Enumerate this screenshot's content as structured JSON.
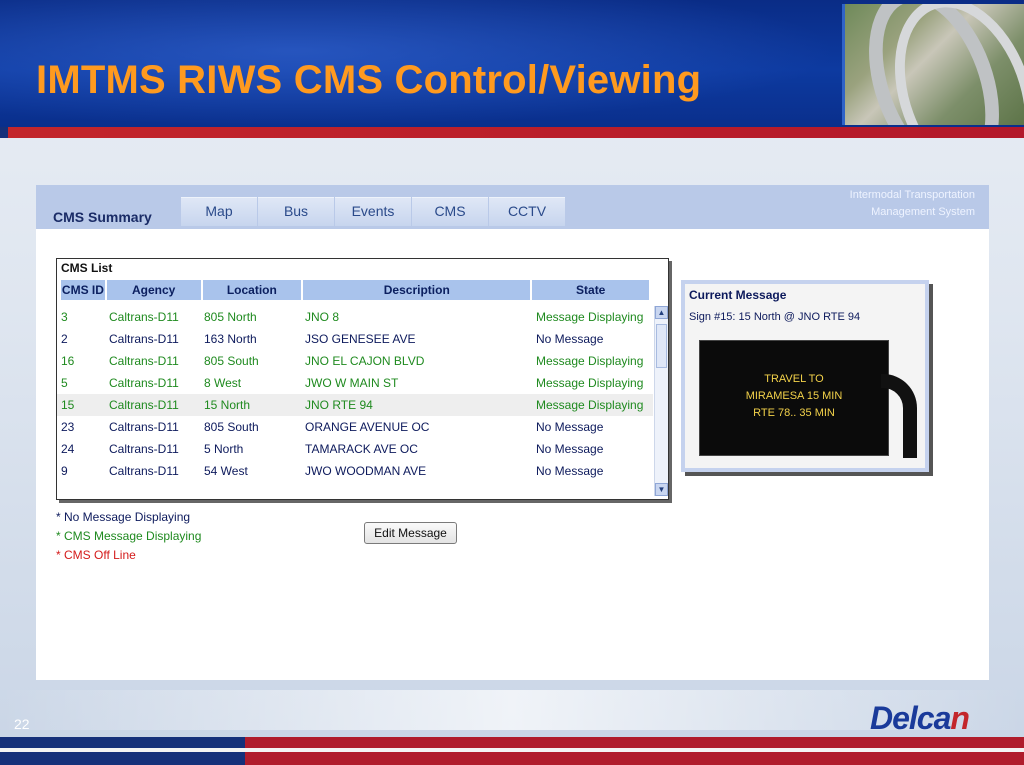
{
  "slide": {
    "title": "IMTMS RIWS CMS Control/Viewing",
    "page_number": "22",
    "logo_text_main": "Delca",
    "logo_text_accent": "n",
    "colors": {
      "title": "#ff9a1f",
      "header_blue": "#0d3aa0",
      "rule_red": "#c3262b",
      "logo_blue": "#1a3a9a"
    }
  },
  "app": {
    "page_label": "CMS Summary",
    "tabs": [
      {
        "label": "Map"
      },
      {
        "label": "Bus"
      },
      {
        "label": "Events"
      },
      {
        "label": "CMS"
      },
      {
        "label": "CCTV"
      }
    ],
    "brand_line1": "Intermodal Transportation",
    "brand_line2": "Management System"
  },
  "cms_list": {
    "title": "CMS List",
    "columns": [
      "CMS ID",
      "Agency",
      "Location",
      "Description",
      "State"
    ],
    "rows": [
      {
        "id": "3",
        "agency": "Caltrans-D11",
        "location": "805 North",
        "description": "JNO 8",
        "state": "Message Displaying",
        "status": "displaying"
      },
      {
        "id": "2",
        "agency": "Caltrans-D11",
        "location": "163 North",
        "description": "JSO GENESEE AVE",
        "state": "No Message",
        "status": "none"
      },
      {
        "id": "16",
        "agency": "Caltrans-D11",
        "location": "805 South",
        "description": "JNO EL CAJON BLVD",
        "state": "Message Displaying",
        "status": "displaying"
      },
      {
        "id": "5",
        "agency": "Caltrans-D11",
        "location": "8 West",
        "description": "JWO W MAIN ST",
        "state": "Message Displaying",
        "status": "displaying"
      },
      {
        "id": "15",
        "agency": "Caltrans-D11",
        "location": "15 North",
        "description": "JNO RTE 94",
        "state": "Message Displaying",
        "status": "displaying",
        "selected": true
      },
      {
        "id": "23",
        "agency": "Caltrans-D11",
        "location": "805 South",
        "description": "ORANGE AVENUE OC",
        "state": "No Message",
        "status": "none"
      },
      {
        "id": "24",
        "agency": "Caltrans-D11",
        "location": "5 North",
        "description": "TAMARACK AVE OC",
        "state": "No Message",
        "status": "none"
      },
      {
        "id": "9",
        "agency": "Caltrans-D11",
        "location": "54 West",
        "description": "JWO WOODMAN AVE",
        "state": "No Message",
        "status": "none"
      }
    ]
  },
  "legend": {
    "no_message": "* No Message Displaying",
    "displaying": "* CMS Message Displaying",
    "offline": "* CMS Off Line"
  },
  "edit_button": {
    "label": "Edit Message"
  },
  "current_message": {
    "title": "Current Message",
    "sign": "Sign #15: 15 North @ JNO RTE 94",
    "lines": [
      "TRAVEL TO",
      "MIRAMESA 15 MIN",
      "RTE 78.. 35 MIN"
    ]
  }
}
